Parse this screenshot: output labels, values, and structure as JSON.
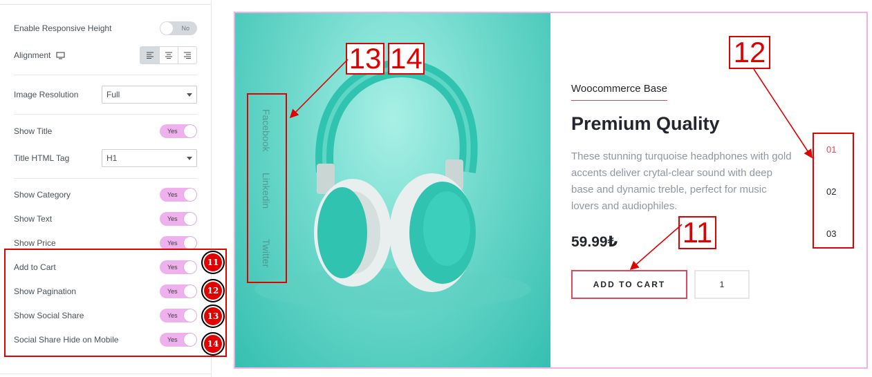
{
  "settings": {
    "responsive_height": {
      "label": "Enable Responsive Height",
      "value": "No"
    },
    "alignment": {
      "label": "Alignment"
    },
    "image_resolution": {
      "label": "Image Resolution",
      "value": "Full"
    },
    "show_title": {
      "label": "Show Title",
      "value": "Yes"
    },
    "title_tag": {
      "label": "Title HTML Tag",
      "value": "H1"
    },
    "show_category": {
      "label": "Show Category",
      "value": "Yes"
    },
    "show_text": {
      "label": "Show Text",
      "value": "Yes"
    },
    "show_price": {
      "label": "Show Price",
      "value": "Yes"
    },
    "add_to_cart": {
      "label": "Add to Cart",
      "value": "Yes"
    },
    "show_pagination": {
      "label": "Show Pagination",
      "value": "Yes"
    },
    "show_social": {
      "label": "Show Social Share",
      "value": "Yes"
    },
    "social_hide_mobile": {
      "label": "Social Share Hide on Mobile",
      "value": "Yes"
    }
  },
  "badges": [
    "11",
    "12",
    "13",
    "14"
  ],
  "callouts": {
    "c13": "13",
    "c14": "14",
    "c12": "12",
    "c11": "11"
  },
  "product": {
    "category": "Woocommerce Base",
    "title": "Premium Quality",
    "description": "These stunning turquoise headphones with gold accents deliver crytal-clear sound with deep base and dynamic treble, perfect for music lovers and audiophiles.",
    "price": "59.99₺",
    "cart_label": "ADD TO CART",
    "quantity": "1"
  },
  "social": [
    "Facebook",
    "Linkedin",
    "Twitter"
  ],
  "pagination": [
    "01",
    "02",
    "03"
  ],
  "colors": {
    "accent": "#e0485a",
    "toggle_on": "#eeb1ee",
    "annotation": "#e00000"
  }
}
